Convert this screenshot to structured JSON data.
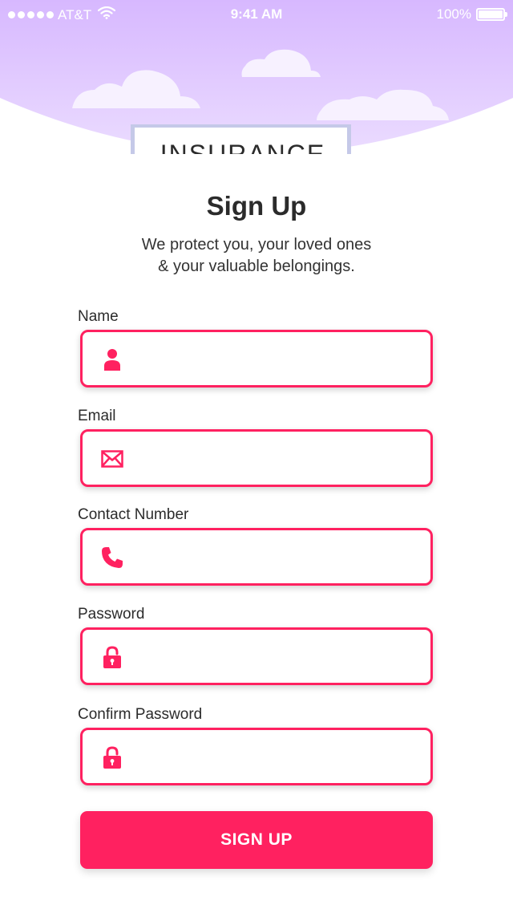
{
  "status_bar": {
    "carrier": "AT&T",
    "time": "9:41 AM",
    "battery": "100%"
  },
  "hero": {
    "sign_text": "INSURANCE"
  },
  "title": "Sign Up",
  "subtitle": {
    "line1": "We protect you, your loved ones",
    "line2": "& your valuable belongings."
  },
  "form": {
    "fields": [
      {
        "label": "Name",
        "icon": "user-icon",
        "value": ""
      },
      {
        "label": "Email",
        "icon": "envelope-icon",
        "value": ""
      },
      {
        "label": "Contact Number",
        "icon": "phone-icon",
        "value": ""
      },
      {
        "label": "Password",
        "icon": "lock-icon",
        "value": ""
      },
      {
        "label": "Confirm Password",
        "icon": "lock-icon",
        "value": ""
      }
    ],
    "submit_label": "SIGN UP"
  },
  "colors": {
    "accent": "#ff2160",
    "hero_top": "#d7b8ff",
    "hero_bottom": "#ebdcff"
  }
}
